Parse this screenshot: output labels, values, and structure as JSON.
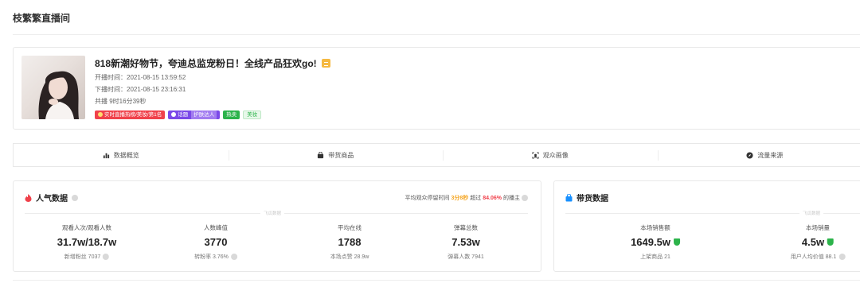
{
  "page": {
    "title": "枝繁繁直播间"
  },
  "live": {
    "title": "818新潮好物节，夸迪总监宠粉日！全线产品狂欢go!",
    "start_time": "开播时间：2021-08-15 13:59:52",
    "end_time": "下播时间：2021-08-15 23:16:31",
    "duration": "共播 9时16分39秒",
    "badges": {
      "rank": "实时直播热榜/美妆/第1名",
      "topic": "话题",
      "topic_sub": "护肤达人",
      "hot": "热卖",
      "category": "美妆"
    }
  },
  "tabs": [
    {
      "label": "数据概览",
      "icon": "bar-chart-icon"
    },
    {
      "label": "带货商品",
      "icon": "shopping-bag-icon"
    },
    {
      "label": "观众画像",
      "icon": "portrait-icon"
    },
    {
      "label": "流量来源",
      "icon": "compass-icon"
    }
  ],
  "popularity": {
    "title": "人气数据",
    "stay_prefix": "平均观众停留时间",
    "stay_time": "3分8秒",
    "stay_mid": "超过",
    "stay_percent": "84.06%",
    "stay_suffix": "的播主",
    "watermark": "飞瓜数据",
    "metrics": [
      {
        "label": "观看人次/观看人数",
        "value": "31.7w/18.7w",
        "sub": "新增粉丝 7037"
      },
      {
        "label": "人数峰值",
        "value": "3770",
        "sub": "转粉率 3.76%"
      },
      {
        "label": "平均在线",
        "value": "1788",
        "sub": "本场点赞 28.9w"
      },
      {
        "label": "弹幕总数",
        "value": "7.53w",
        "sub": "弹幕人数 7941"
      }
    ]
  },
  "goods": {
    "title": "带货数据",
    "watermark": "飞瓜数据",
    "metrics": [
      {
        "label": "本场销售额",
        "value": "1649.5w",
        "sub": "上架商品 21"
      },
      {
        "label": "本场销量",
        "value": "4.5w",
        "sub": "用户人均价值 88.1"
      }
    ]
  },
  "colors": {
    "accent_red": "#f0414b",
    "accent_orange": "#f5a623",
    "verified_green": "#2cb34a"
  }
}
